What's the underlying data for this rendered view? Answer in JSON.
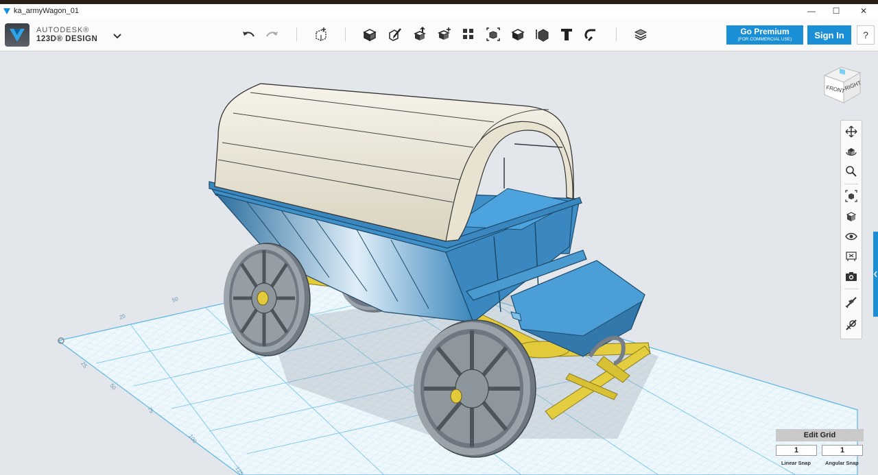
{
  "window": {
    "title": "ka_armyWagon_01",
    "controls": {
      "minimize": "—",
      "maximize": "☐",
      "close": "✕"
    }
  },
  "brand": {
    "line1": "AUTODESK®",
    "line2": "123D® DESIGN"
  },
  "toolbar": {
    "icons": [
      "undo-icon",
      "redo-icon",
      "transform-icon",
      "primitives-icon",
      "sketch-icon",
      "construct-icon",
      "modify-icon",
      "pattern-icon",
      "grouping-icon",
      "combine-icon",
      "measure-icon",
      "text-icon",
      "snap-icon",
      "material-icon"
    ]
  },
  "account": {
    "premium_label": "Go Premium",
    "premium_sub": "(FOR COMMERCIAL USE)",
    "signin_label": "Sign In",
    "help_label": "?"
  },
  "viewcube": {
    "front_label": "FRONT",
    "right_label": "RIGHT"
  },
  "navbar": {
    "icons": [
      "pan-icon",
      "orbit-icon",
      "zoom-icon",
      "fit-icon",
      "view-icon",
      "visibility-icon",
      "materials-icon",
      "camera-icon",
      "snap-icon",
      "settings-icon"
    ]
  },
  "grid": {
    "edit_label": "Edit Grid",
    "linear_snap_value": "1",
    "linear_snap_label": "Linear Snap",
    "angular_snap_value": "1",
    "angular_snap_label": "Angular Snap",
    "axis_ticks": [
      "25",
      "50",
      "75",
      "100",
      "125",
      "25",
      "50"
    ]
  },
  "colors": {
    "accent": "#1a8fd6",
    "grid_line": "#7fc4e8",
    "wagon_body": "#3f8fc8",
    "canopy": "#e9e4d4",
    "chassis": "#e3cc3c",
    "wheel": "#8a929c"
  }
}
